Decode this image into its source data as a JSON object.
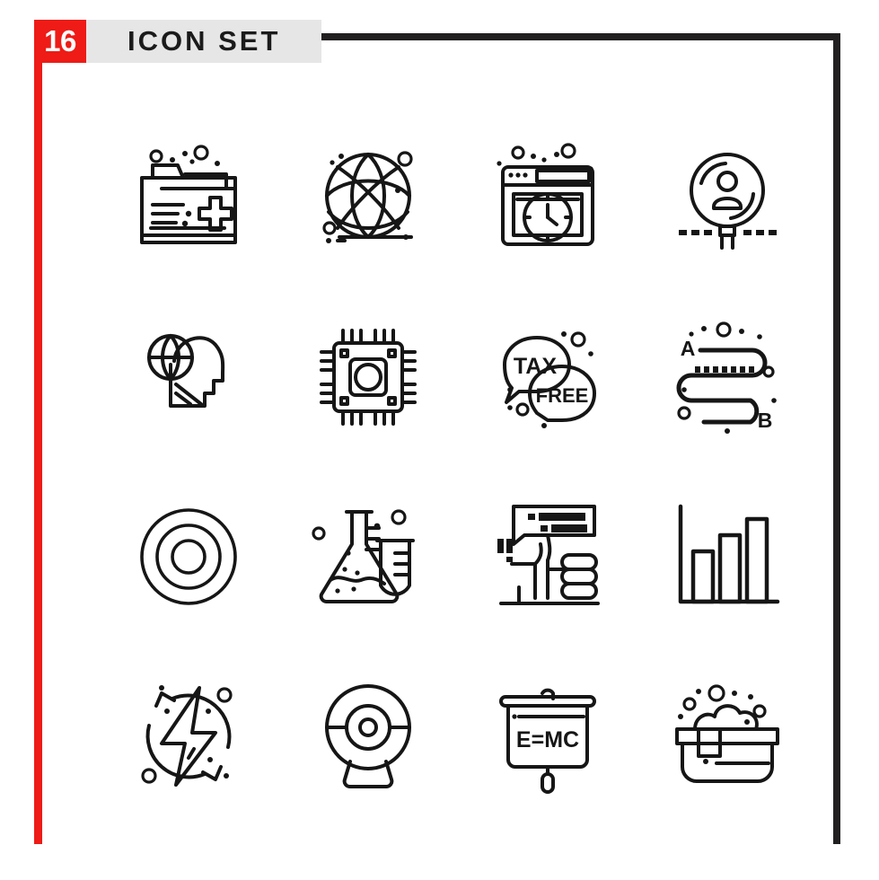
{
  "header": {
    "count_badge": "16",
    "title": "ICON SET",
    "accent_color": "#ee1b16",
    "banner_color": "#e6e6e6",
    "line_color": "#221f20"
  },
  "grid": {
    "columns": 4,
    "rows": 4,
    "total_icons": 16,
    "stroke_color": "#161616",
    "style": "outline"
  },
  "icons": [
    {
      "index": 1,
      "name": "medical-folder-icon",
      "label": "Medical Folder"
    },
    {
      "index": 2,
      "name": "globe-network-icon",
      "label": "Global Network"
    },
    {
      "index": 3,
      "name": "browser-clock-icon",
      "label": "Browser Clock"
    },
    {
      "index": 4,
      "name": "search-user-icon",
      "label": "Search User"
    },
    {
      "index": 5,
      "name": "global-mind-icon",
      "label": "Global Mind"
    },
    {
      "index": 6,
      "name": "processor-chip-icon",
      "label": "Processor Chip"
    },
    {
      "index": 7,
      "name": "tax-free-bubbles-icon",
      "label": "Tax Free",
      "text_primary": "TAX",
      "text_secondary": "FREE"
    },
    {
      "index": 8,
      "name": "route-a-to-b-icon",
      "label": "Route A to B",
      "text_start": "A",
      "text_end": "B"
    },
    {
      "index": 9,
      "name": "target-circles-icon",
      "label": "Target"
    },
    {
      "index": 10,
      "name": "lab-flask-icon",
      "label": "Laboratory Flask"
    },
    {
      "index": 11,
      "name": "thumbs-up-feedback-icon",
      "label": "Thumbs Up Feedback"
    },
    {
      "index": 12,
      "name": "bar-chart-icon",
      "label": "Bar Chart"
    },
    {
      "index": 13,
      "name": "renewable-energy-icon",
      "label": "Renewable Energy"
    },
    {
      "index": 14,
      "name": "webcam-icon",
      "label": "Webcam"
    },
    {
      "index": 15,
      "name": "presentation-board-icon",
      "label": "Presentation Board",
      "text": "E=MC"
    },
    {
      "index": 16,
      "name": "bathtub-bubbles-icon",
      "label": "Bathtub"
    }
  ]
}
